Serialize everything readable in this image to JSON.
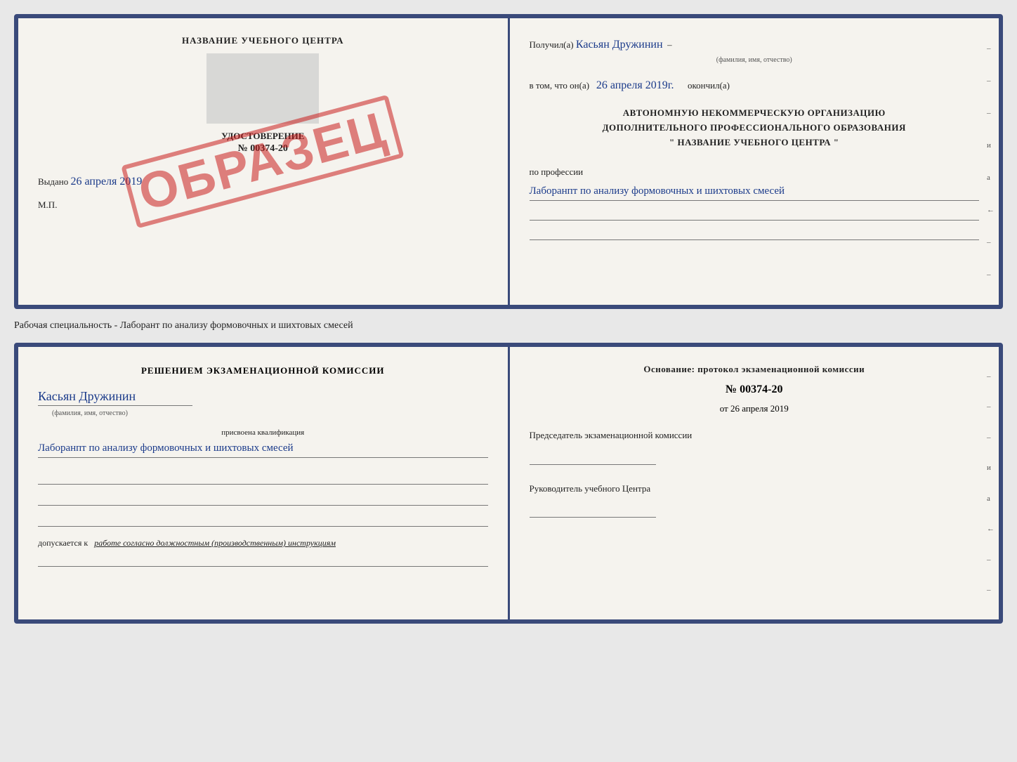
{
  "top_document": {
    "left": {
      "title": "НАЗВАНИЕ УЧЕБНОГО ЦЕНТРА",
      "stamp": "ОБРАЗЕЦ",
      "cert_label": "УДОСТОВЕРЕНИЕ",
      "cert_number": "№ 00374-20",
      "issued_prefix": "Выдано",
      "issued_date": "26 апреля 2019",
      "mp_label": "М.П."
    },
    "right": {
      "received_label": "Получил(а)",
      "received_name": "Касьян Дружинин",
      "fio_hint": "(фамилия, имя, отчество)",
      "date_prefix": "в том, что он(а)",
      "date_value": "26 апреля 2019г.",
      "finished_label": "окончил(а)",
      "org_line1": "АВТОНОМНУЮ НЕКОММЕРЧЕСКУЮ ОРГАНИЗАЦИЮ",
      "org_line2": "ДОПОЛНИТЕЛЬНОГО ПРОФЕССИОНАЛЬНОГО ОБРАЗОВАНИЯ",
      "org_line3": "\"   НАЗВАНИЕ УЧЕБНОГО ЦЕНТРА   \"",
      "profession_prefix": "по профессии",
      "profession_value": "Лаборанпт по анализу формовочных и шихтовых смесей",
      "side_marks": [
        "–",
        "–",
        "–",
        "и",
        "а",
        "←",
        "–",
        "–"
      ]
    }
  },
  "specialty_label": "Рабочая специальность - Лаборант по анализу формовочных и шихтовых смесей",
  "bottom_document": {
    "left": {
      "commission_title": "Решением экзаменационной комиссии",
      "name": "Касьян Дружинин",
      "fio_hint": "(фамилия, имя, отчество)",
      "qualification_prefix": "присвоена квалификация",
      "qualification_value": "Лаборанпт по анализу формовочных и шихтовых смесей",
      "допускается_prefix": "допускается к",
      "допускается_value": "работе согласно должностным (производственным) инструкциям"
    },
    "right": {
      "osnование": "Основание: протокол экзаменационной комиссии",
      "protocol_number": "№ 00374-20",
      "date_prefix": "от",
      "date_value": "26 апреля 2019",
      "chairman_label": "Председатель экзаменационной комиссии",
      "head_label": "Руководитель учебного Центра",
      "side_marks": [
        "–",
        "–",
        "–",
        "и",
        "а",
        "←",
        "–",
        "–"
      ]
    }
  }
}
